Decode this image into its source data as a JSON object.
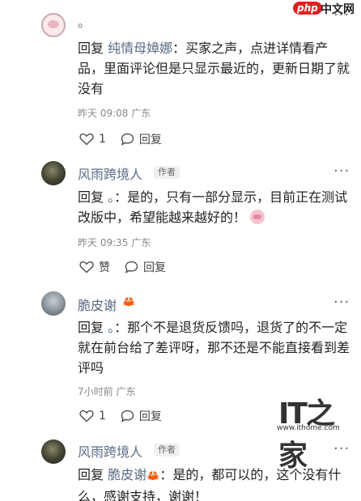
{
  "watermarks": {
    "php": "php",
    "php_cn": "中文网",
    "ithome_logo": "IT之家",
    "ithome_url": "www.ithome.com"
  },
  "comments": [
    {
      "username": "。",
      "reply_prefix": "回复",
      "mention": "纯情母嫜娜",
      "text": "：买家之声，点进详情看产品，里面评论但是只显示最近的，更新日期了就没有",
      "time": "昨天 09:08",
      "location": "广东",
      "likes": "1",
      "reply_label": "回复"
    },
    {
      "username": "风雨跨境人",
      "author_tag": "作者",
      "reply_prefix": "回复",
      "mention": "。",
      "text": "：是的，只有一部分显示，目前正在测试改版中，希望能越来越好的！",
      "time": "昨天 09:35",
      "location": "广东",
      "like_label": "赞",
      "reply_label": "回复"
    },
    {
      "username": "脆皮谢",
      "reply_prefix": "回复",
      "mention": "。",
      "text": "：那个不是退货反馈吗，退货了的不一定就在前台给了差评呀，那不还是不能直接看到差评吗",
      "time": "7小时前",
      "location": "广东",
      "likes": "1",
      "reply_label": "回复"
    },
    {
      "username": "风雨跨境人",
      "author_tag": "作者",
      "reply_prefix": "回复",
      "mention": "脆皮谢",
      "text": "：是的，都可以的，这个没有什么，感谢支持，谢谢！"
    }
  ]
}
